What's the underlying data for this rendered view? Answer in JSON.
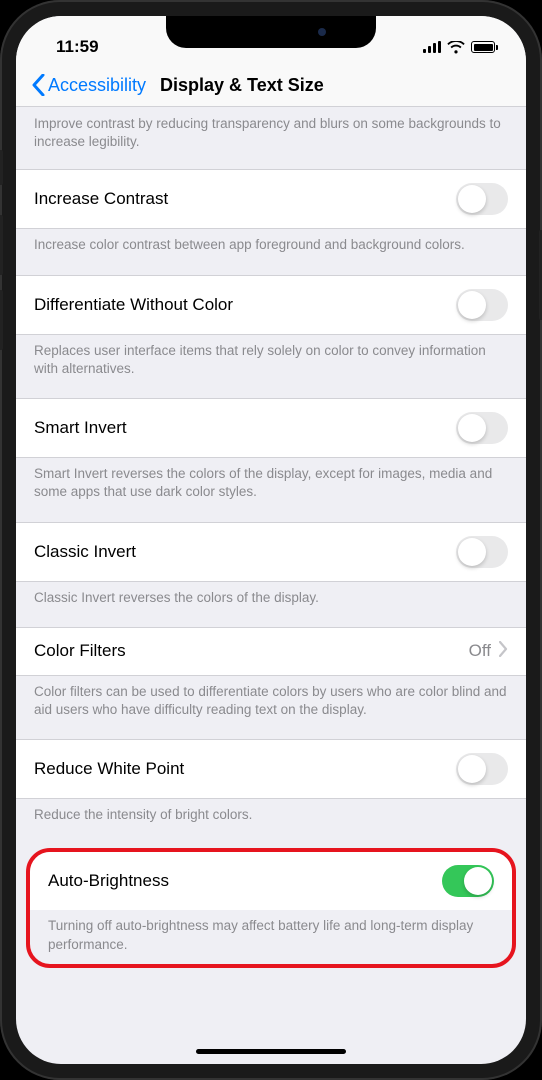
{
  "status": {
    "time": "11:59"
  },
  "nav": {
    "back_label": "Accessibility",
    "title": "Display & Text Size"
  },
  "top_description": "Improve contrast by reducing transparency and blurs on some backgrounds to increase legibility.",
  "settings": {
    "increase_contrast": {
      "label": "Increase Contrast",
      "enabled": false,
      "description": "Increase color contrast between app foreground and background colors."
    },
    "differentiate_without_color": {
      "label": "Differentiate Without Color",
      "enabled": false,
      "description": "Replaces user interface items that rely solely on color to convey information with alternatives."
    },
    "smart_invert": {
      "label": "Smart Invert",
      "enabled": false,
      "description": "Smart Invert reverses the colors of the display, except for images, media and some apps that use dark color styles."
    },
    "classic_invert": {
      "label": "Classic Invert",
      "enabled": false,
      "description": "Classic Invert reverses the colors of the display."
    },
    "color_filters": {
      "label": "Color Filters",
      "value": "Off",
      "description": "Color filters can be used to differentiate colors by users who are color blind and aid users who have difficulty reading text on the display."
    },
    "reduce_white_point": {
      "label": "Reduce White Point",
      "enabled": false,
      "description": "Reduce the intensity of bright colors."
    },
    "auto_brightness": {
      "label": "Auto-Brightness",
      "enabled": true,
      "description": "Turning off auto-brightness may affect battery life and long-term display performance."
    }
  }
}
